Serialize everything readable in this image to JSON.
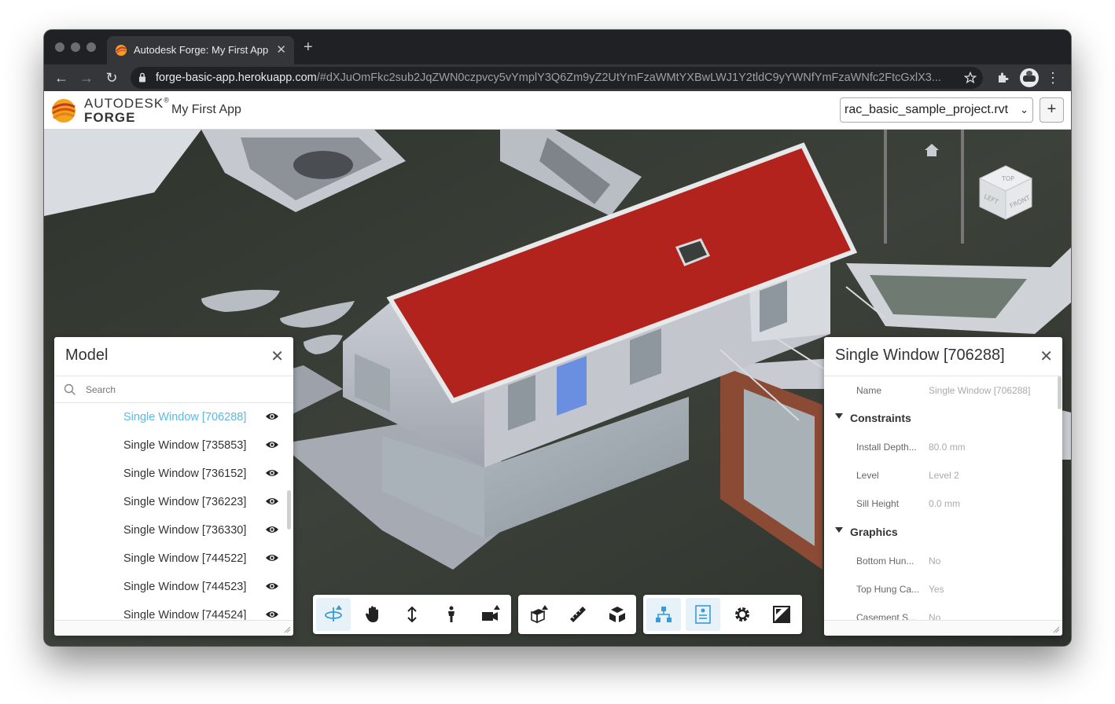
{
  "browser": {
    "tab": {
      "title": "Autodesk Forge: My First App"
    },
    "address": {
      "host": "forge-basic-app.herokuapp.com",
      "rest": "/#dXJuOmFkc2sub2JqZWN0czpvcy5vYmplY3Q6Zm9yZ2UtYmFzaWMtYXBwLWJ1Y2tldC9yYWNfYmFzaWNfc2FtcGxlX3..."
    }
  },
  "header": {
    "logo_line1": "AUTODESK",
    "logo_line1_mark": "®",
    "logo_line2": "FORGE",
    "app_title": "My First App",
    "model_select": "rac_basic_sample_project.rvt",
    "add_button": "+"
  },
  "model_panel": {
    "title": "Model",
    "search_placeholder": "Search",
    "items": [
      {
        "label": "Single Window [706288]",
        "selected": true
      },
      {
        "label": "Single Window [735853]"
      },
      {
        "label": "Single Window [736152]"
      },
      {
        "label": "Single Window [736223]"
      },
      {
        "label": "Single Window [736330]"
      },
      {
        "label": "Single Window [744522]"
      },
      {
        "label": "Single Window [744523]"
      },
      {
        "label": "Single Window [744524]"
      }
    ]
  },
  "properties_panel": {
    "title": "Single Window [706288]",
    "name_key": "Name",
    "name_value": "Single Window [706288]",
    "constraints": {
      "label": "Constraints",
      "rows": [
        {
          "key": "Install Depth...",
          "value": "80.0 mm"
        },
        {
          "key": "Level",
          "value": "Level 2"
        },
        {
          "key": "Sill Height",
          "value": "0.0 mm"
        }
      ]
    },
    "graphics": {
      "label": "Graphics",
      "rows": [
        {
          "key": "Bottom Hun...",
          "value": "No"
        },
        {
          "key": "Top Hung Ca...",
          "value": "Yes"
        },
        {
          "key": "Casement S...",
          "value": "No"
        }
      ]
    }
  },
  "viewcube": {
    "top": "TOP",
    "left": "LEFT",
    "front": "FRONT"
  },
  "colors": {
    "roof": "#b3231d",
    "selected": "#5ab9e5",
    "ground": "#3a3e37"
  },
  "toolbar_icons": [
    "orbit-icon",
    "pan-icon",
    "zoom-icon",
    "first-person-icon",
    "camera-icon",
    "section-icon",
    "measure-icon",
    "explode-icon",
    "model-browser-icon",
    "properties-icon",
    "settings-icon",
    "fullscreen-icon"
  ]
}
